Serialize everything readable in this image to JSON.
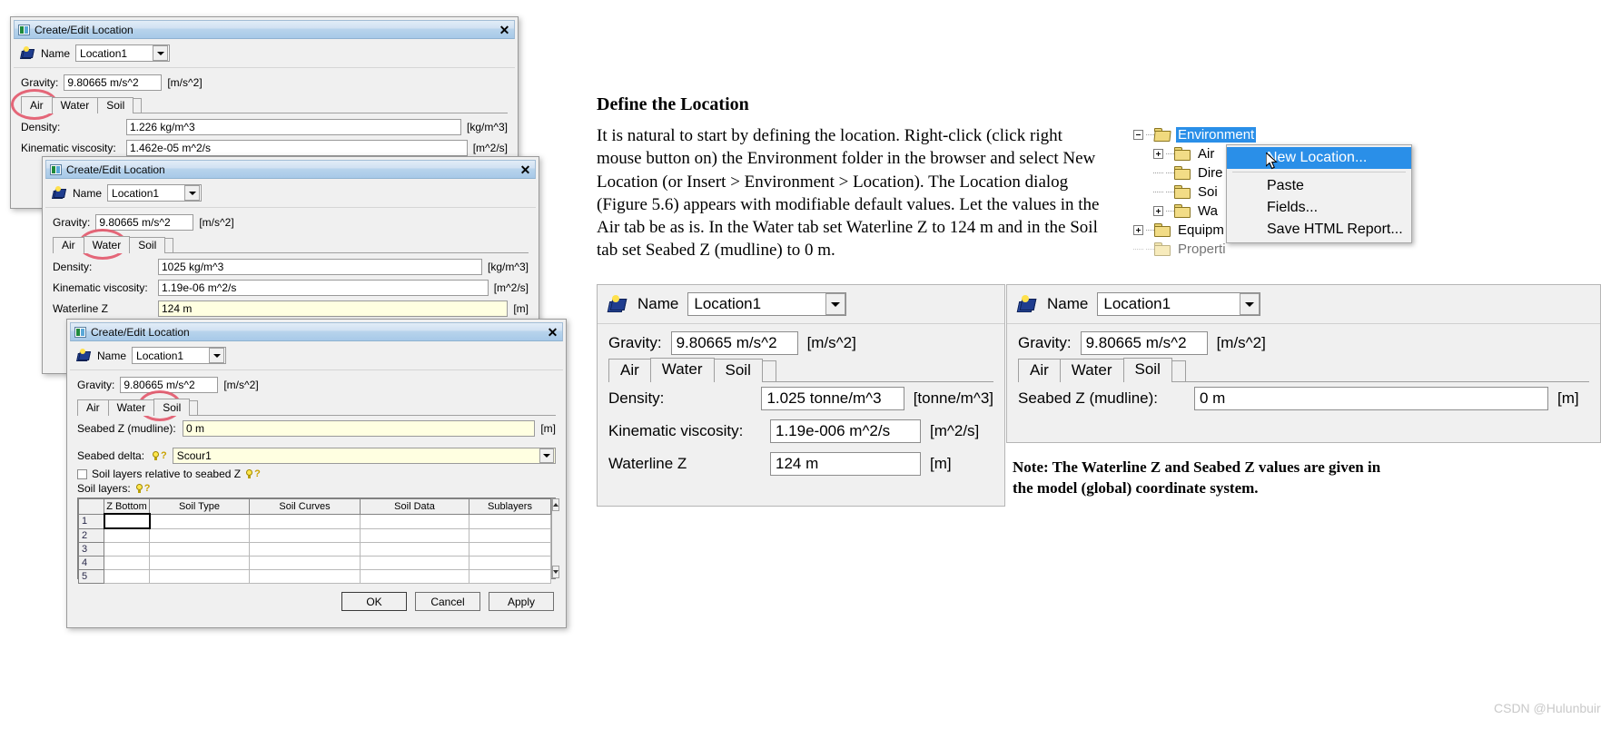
{
  "dialogs": [
    {
      "title": "Create/Edit Location",
      "close_label": "✕",
      "name_label": "Name",
      "name_value": "Location1",
      "gravity_label": "Gravity:",
      "gravity_value": "9.80665 m/s^2",
      "gravity_unit": "[m/s^2]",
      "tabs": [
        "Air",
        "Water",
        "Soil"
      ],
      "active_tab": "Air",
      "fields": [
        {
          "label": "Density:",
          "value": "1.226 kg/m^3",
          "unit": "[kg/m^3]"
        },
        {
          "label": "Kinematic viscosity:",
          "value": "1.462e-05 m^2/s",
          "unit": "[m^2/s]"
        }
      ]
    },
    {
      "title": "Create/Edit Location",
      "close_label": "✕",
      "name_label": "Name",
      "name_value": "Location1",
      "gravity_label": "Gravity:",
      "gravity_value": "9.80665 m/s^2",
      "gravity_unit": "[m/s^2]",
      "tabs": [
        "Air",
        "Water",
        "Soil"
      ],
      "active_tab": "Water",
      "fields": [
        {
          "label": "Density:",
          "value": "1025 kg/m^3",
          "unit": "[kg/m^3]"
        },
        {
          "label": "Kinematic viscosity:",
          "value": "1.19e-06 m^2/s",
          "unit": "[m^2/s]"
        },
        {
          "label": "Waterline Z",
          "value": "124 m",
          "unit": "[m]"
        }
      ]
    },
    {
      "title": "Create/Edit Location",
      "close_label": "✕",
      "name_label": "Name",
      "name_value": "Location1",
      "gravity_label": "Gravity:",
      "gravity_value": "9.80665 m/s^2",
      "gravity_unit": "[m/s^2]",
      "tabs": [
        "Air",
        "Water",
        "Soil"
      ],
      "active_tab": "Soil",
      "seabed_z_label": "Seabed Z (mudline):",
      "seabed_z_value": "0 m",
      "seabed_z_unit": "[m]",
      "seabed_delta_label": "Seabed delta:",
      "seabed_delta_value": "Scour1",
      "soil_layers_relative_label": "Soil layers relative to seabed Z",
      "soil_layers_relative_checked": false,
      "soil_layers_label": "Soil layers:",
      "hint_marker": "?",
      "table": {
        "columns": [
          "",
          "Z Bottom",
          "Soil Type",
          "Soil Curves",
          "Soil Data",
          "Sublayers"
        ],
        "rows": [
          {
            "n": "1",
            "cells": [
              "",
              "",
              "",
              "",
              ""
            ]
          },
          {
            "n": "2",
            "cells": [
              "",
              "",
              "",
              "",
              ""
            ]
          },
          {
            "n": "3",
            "cells": [
              "",
              "",
              "",
              "",
              ""
            ]
          },
          {
            "n": "4",
            "cells": [
              "",
              "",
              "",
              "",
              ""
            ]
          },
          {
            "n": "5",
            "cells": [
              "",
              "",
              "",
              "",
              ""
            ]
          }
        ],
        "selected_cell": {
          "row": 0,
          "col": 0
        }
      },
      "buttons": {
        "ok": "OK",
        "cancel": "Cancel",
        "apply": "Apply"
      }
    }
  ],
  "document": {
    "heading": "Define the Location",
    "body": "It is natural to start by defining the location. Right-click (click right mouse button on) the Environment folder in the browser and select New Location (or Insert > Environment > Location). The Location dialog (Figure 5.6) appears with modifiable default values. Let the values in the Air tab be as is. In the Water tab set Waterline Z to 124 m and in the Soil tab set Seabed Z (mudline) to 0 m."
  },
  "tree": {
    "nodes": [
      {
        "label": "Environment",
        "expander": "minus",
        "selected": true,
        "indent": 0,
        "open_folder": true
      },
      {
        "label": "Air",
        "expander": "plus",
        "selected": false,
        "indent": 1,
        "open_folder": false
      },
      {
        "label": "Dire",
        "expander": "none",
        "selected": false,
        "indent": 1,
        "open_folder": false
      },
      {
        "label": "Soi",
        "expander": "none",
        "selected": false,
        "indent": 1,
        "open_folder": false
      },
      {
        "label": "Wa",
        "expander": "plus",
        "selected": false,
        "indent": 1,
        "open_folder": false
      },
      {
        "label": "Equipm",
        "expander": "plus",
        "selected": false,
        "indent": 0,
        "open_folder": false
      },
      {
        "label": "Properti",
        "expander": "none",
        "selected": false,
        "indent": 0,
        "open_folder": false
      }
    ]
  },
  "context_menu": {
    "items": [
      {
        "label": "New Location...",
        "highlighted": true,
        "separator_after": true
      },
      {
        "label": "Paste",
        "highlighted": false,
        "separator_after": false
      },
      {
        "label": "Fields...",
        "highlighted": false,
        "separator_after": false
      },
      {
        "label": "Save HTML Report...",
        "highlighted": false,
        "separator_after": false
      }
    ]
  },
  "panel_water": {
    "name_label": "Name",
    "name_value": "Location1",
    "gravity_label": "Gravity:",
    "gravity_value": "9.80665 m/s^2",
    "gravity_unit": "[m/s^2]",
    "tabs": [
      "Air",
      "Water",
      "Soil"
    ],
    "active_tab": "Water",
    "fields": [
      {
        "label": "Density:",
        "value": "1.025 tonne/m^3",
        "unit": "[tonne/m^3]"
      },
      {
        "label": "Kinematic viscosity:",
        "value": "1.19e-006 m^2/s",
        "unit": "[m^2/s]"
      },
      {
        "label": "Waterline Z",
        "value": "124 m",
        "unit": "[m]"
      }
    ]
  },
  "panel_soil": {
    "name_label": "Name",
    "name_value": "Location1",
    "gravity_label": "Gravity:",
    "gravity_value": "9.80665 m/s^2",
    "gravity_unit": "[m/s^2]",
    "tabs": [
      "Air",
      "Water",
      "Soil"
    ],
    "active_tab": "Soil",
    "field": {
      "label": "Seabed Z (mudline):",
      "value": "0 m",
      "unit": "[m]"
    }
  },
  "note": "Note: The Waterline Z and Seabed Z values are given in the model (global) coordinate system.",
  "watermark": "CSDN @Hulunbuir",
  "colors": {
    "accent_blue": "#2a8fe8",
    "annotation_red": "#e2566a",
    "titlebar_blue": "#a7c9e8",
    "field_yellow": "#ffffe1"
  }
}
